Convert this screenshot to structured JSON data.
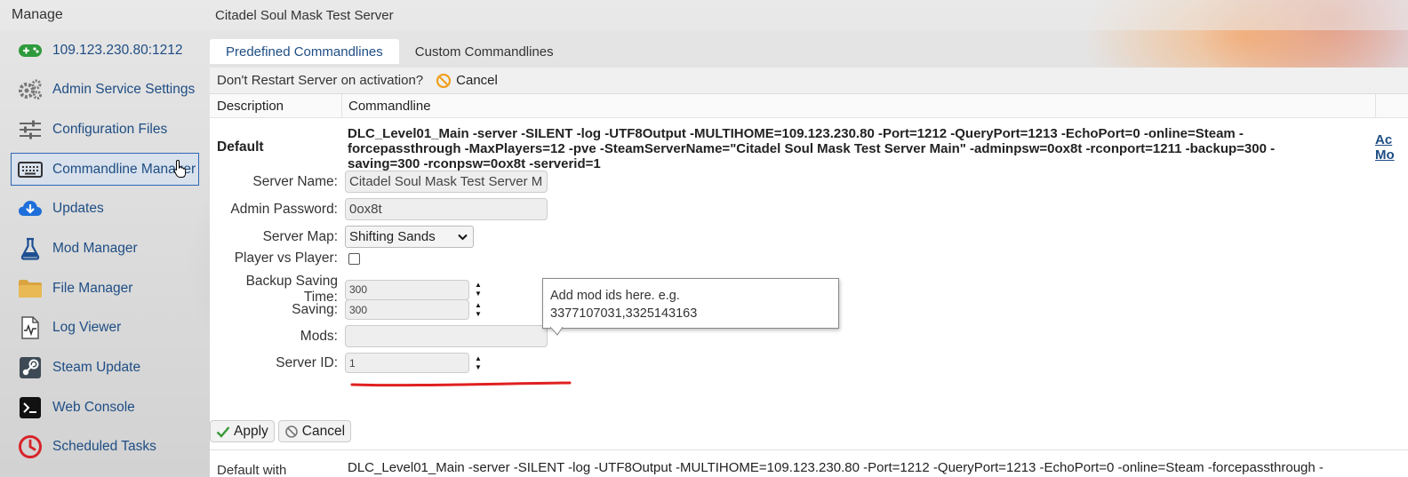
{
  "topbar": {
    "manage": "Manage",
    "title": "Citadel Soul Mask Test Server"
  },
  "sidebar": {
    "items": [
      {
        "label": "109.123.230.80:1212",
        "icon": "gamepad-icon"
      },
      {
        "label": "Admin Service Settings",
        "icon": "gears-icon"
      },
      {
        "label": "Configuration Files",
        "icon": "sliders-icon"
      },
      {
        "label": "Commandline Manager",
        "icon": "keyboard-icon"
      },
      {
        "label": "Updates",
        "icon": "cloud-download-icon"
      },
      {
        "label": "Mod Manager",
        "icon": "flask-icon"
      },
      {
        "label": "File Manager",
        "icon": "folder-icon"
      },
      {
        "label": "Log Viewer",
        "icon": "log-file-icon"
      },
      {
        "label": "Steam Update",
        "icon": "steam-icon"
      },
      {
        "label": "Web Console",
        "icon": "terminal-icon"
      },
      {
        "label": "Scheduled Tasks",
        "icon": "clock-icon"
      }
    ],
    "active_index": 3
  },
  "tabs": {
    "predefined": "Predefined Commandlines",
    "custom": "Custom Commandlines"
  },
  "toolbar": {
    "question": "Don't Restart Server on activation?",
    "cancel": "Cancel"
  },
  "table": {
    "col_description": "Description",
    "col_commandline": "Commandline",
    "row1": {
      "name": "Default",
      "cmd": "DLC_Level01_Main -server -SILENT -log -UTF8Output -MULTIHOME=109.123.230.80 -Port=1212 -QueryPort=1213 -EchoPort=0 -online=Steam -forcepassthrough -MaxPlayers=12 -pve -SteamServerName=\"Citadel Soul Mask Test Server Main\" -adminpsw=0ox8t -rconport=1211 -backup=300 -saving=300 -rconpsw=0ox8t -serverid=1",
      "action_line1": "Ac",
      "action_line2": "Mo"
    },
    "row2": {
      "name": "Default with",
      "cmd": "DLC_Level01_Main -server -SILENT -log -UTF8Output -MULTIHOME=109.123.230.80 -Port=1212 -QueryPort=1213 -EchoPort=0 -online=Steam -forcepassthrough -"
    }
  },
  "form": {
    "server_name_label": "Server Name:",
    "server_name_value": "Citadel Soul Mask Test Server M",
    "admin_password_label": "Admin Password:",
    "admin_password_value": "0ox8t",
    "server_map_label": "Server Map:",
    "server_map_value": "Shifting Sands",
    "pvp_label": "Player vs Player:",
    "backup_label": "Backup Saving Time:",
    "backup_value": "300",
    "saving_label": "Saving:",
    "saving_value": "300",
    "mods_label": "Mods:",
    "mods_value": "",
    "server_id_label": "Server ID:",
    "server_id_value": "1"
  },
  "tooltip": {
    "line1": "Add mod ids here. e.g.",
    "line2": "3377107031,3325143163"
  },
  "buttons": {
    "apply": "Apply",
    "cancel": "Cancel"
  },
  "colors": {
    "accent": "#1e4d84",
    "highlight": "#e02020"
  }
}
